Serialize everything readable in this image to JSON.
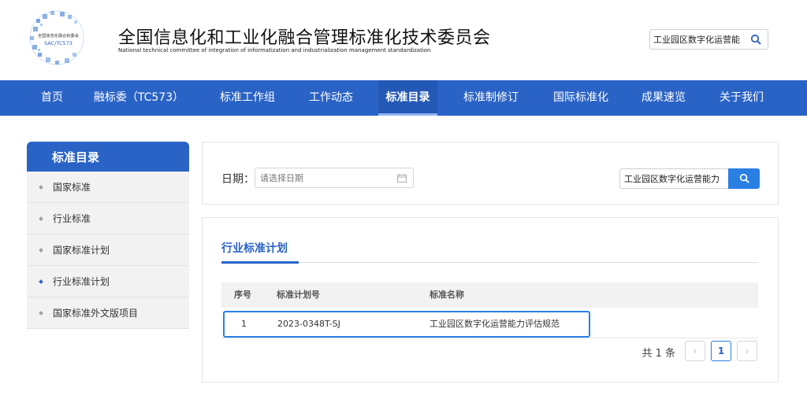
{
  "header": {
    "logo": {
      "line1": "全国信息化融合标委会",
      "line2": "SAC/TC573"
    },
    "title": "全国信息化和工业化融合管理标准化技术委员会",
    "subtitle": "National technical committee of integration of informatization and industrialization management standardization",
    "search_value": "工业园区数字化运营能",
    "search_icon": "search-icon"
  },
  "nav": {
    "items": [
      {
        "label": "首页"
      },
      {
        "label": "融标委（TC573）"
      },
      {
        "label": "标准工作组"
      },
      {
        "label": "工作动态"
      },
      {
        "label": "标准目录"
      },
      {
        "label": "标准制修订"
      },
      {
        "label": "国际标准化"
      },
      {
        "label": "成果速览"
      },
      {
        "label": "关于我们"
      }
    ],
    "active": "标准目录"
  },
  "sidebar": {
    "title": "标准目录",
    "items": [
      {
        "label": "国家标准"
      },
      {
        "label": "行业标准"
      },
      {
        "label": "国家标准计划"
      },
      {
        "label": "行业标准计划"
      },
      {
        "label": "国家标准外文版项目"
      }
    ],
    "active": "行业标准计划"
  },
  "filter": {
    "date_label": "日期：",
    "date_placeholder": "请选择日期",
    "search_value": "工业园区数字化运营能力",
    "calendar_icon": "calendar-icon",
    "search_icon": "search-icon"
  },
  "results": {
    "section_title": "行业标准计划",
    "columns": [
      "序号",
      "标准计划号",
      "标准名称"
    ],
    "rows": [
      {
        "index": "1",
        "plan_no": "2023-0348T-SJ",
        "name": "工业园区数字化运营能力评估规范"
      }
    ],
    "pager": {
      "total": "共 1 条",
      "prev": "‹",
      "current": "1",
      "next": "›"
    }
  },
  "colors": {
    "primary": "#2a63c6",
    "accent": "#2a7fe3",
    "sidebar_bg": "#f2f2f2"
  }
}
